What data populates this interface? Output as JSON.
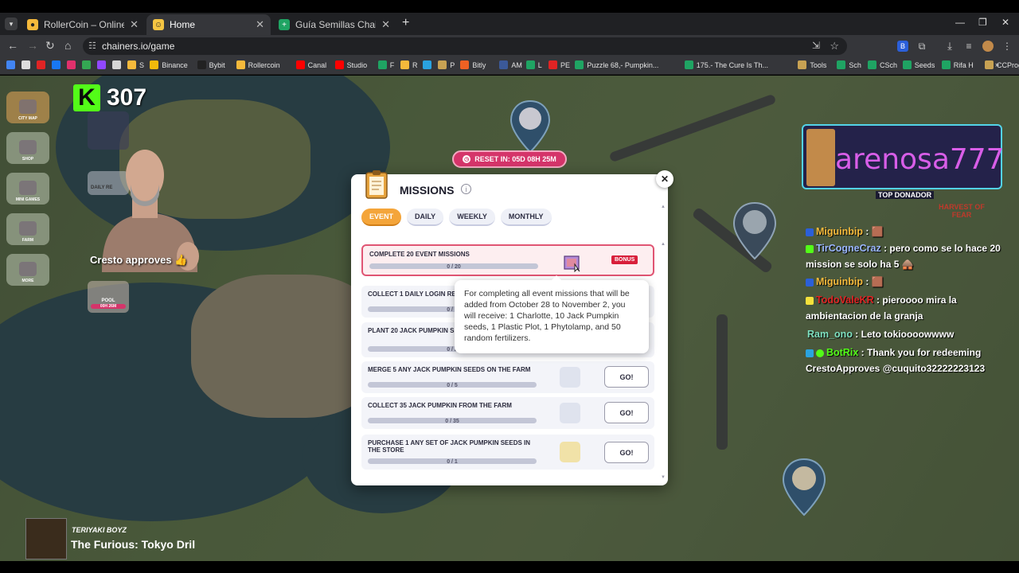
{
  "browser": {
    "tabs": [
      {
        "title": "RollerCoin – Online Bitcoin Mi",
        "fav_color": "#f5b93b",
        "active": false
      },
      {
        "title": "Home",
        "fav_color": "#f5c542",
        "active": true
      },
      {
        "title": "Guía Semillas Chainers by Piero",
        "fav_color": "#1fa463",
        "active": false
      }
    ],
    "url": "chainers.io/game",
    "bookmarks": [
      {
        "label": "",
        "color": "#4285f4"
      },
      {
        "label": "",
        "color": "#ddd"
      },
      {
        "label": "",
        "color": "#e02424"
      },
      {
        "label": "",
        "color": "#1877f2"
      },
      {
        "label": "",
        "color": "#e1306c"
      },
      {
        "label": "",
        "color": "#34a853"
      },
      {
        "label": "",
        "color": "#9147ff"
      },
      {
        "label": "",
        "color": "#d6d6d6"
      },
      {
        "label": "S",
        "color": "#f5b93b"
      },
      {
        "label": "Binance",
        "color": "#f0b90b"
      },
      {
        "label": "Bybit",
        "color": "#222"
      },
      {
        "label": "Rollercoin",
        "color": "#f5b93b"
      },
      {
        "label": "Canal",
        "color": "#ff0000"
      },
      {
        "label": "Studio",
        "color": "#ff0000"
      },
      {
        "label": "F",
        "color": "#1fa463"
      },
      {
        "label": "R",
        "color": "#f5b93b"
      },
      {
        "label": "",
        "color": "#2aa3e0"
      },
      {
        "label": "P",
        "color": "#c8a253"
      },
      {
        "label": "Bitly",
        "color": "#ee6123"
      },
      {
        "label": "AM",
        "color": "#3b5998"
      },
      {
        "label": "L",
        "color": "#1fa463"
      },
      {
        "label": "PE",
        "color": "#e02424"
      },
      {
        "label": "Puzzle 68,- Pumpkin...",
        "color": "#1fa463"
      },
      {
        "label": "175.- The Cure Is Th...",
        "color": "#1fa463"
      },
      {
        "label": "Tools",
        "color": "#c8a253"
      },
      {
        "label": "Sch",
        "color": "#1fa463"
      },
      {
        "label": "CSch",
        "color": "#1fa463"
      },
      {
        "label": "Seeds",
        "color": "#1fa463"
      },
      {
        "label": "Rifa H",
        "color": "#1fa463"
      },
      {
        "label": "CCProgram",
        "color": "#c8a253"
      }
    ]
  },
  "stream": {
    "kick_count": "307",
    "kick_letter": "K",
    "caption": "Cresto approves 👍",
    "donor_name": "arenosa777",
    "donor_label": "TOP DONADOR",
    "song_artist": "TERIYAKI BOYZ",
    "song_track": "The Furious: Tokyo Dril"
  },
  "game": {
    "reset_label": "RESET IN: 05D 08H 25M",
    "nav": [
      {
        "label": "CITY MAP"
      },
      {
        "label": "SHOP"
      },
      {
        "label": "MINI GAMES"
      },
      {
        "label": "FARM"
      },
      {
        "label": "MORE"
      }
    ],
    "map_labels": {
      "daily": "DAILY RE",
      "pool": "POOL",
      "pool_time": "00H 26M",
      "harvest": "HARVEST OF FEAR"
    }
  },
  "missions": {
    "title": "MISSIONS",
    "close": "✕",
    "tabs": [
      "EVENT",
      "DAILY",
      "WEEKLY",
      "MONTHLY"
    ],
    "bonus": {
      "name": "COMPLETE 20 EVENT MISSIONS",
      "progress": "0 / 20",
      "tag": "BONUS"
    },
    "items": [
      {
        "name": "COLLECT 1 DAILY LOGIN RE",
        "progress": "0 / 1",
        "go": ""
      },
      {
        "name": "PLANT 20 JACK PUMPKIN S",
        "progress": "0 / 2",
        "go": ""
      },
      {
        "name": "MERGE 5 ANY JACK PUMPKIN SEEDS ON THE FARM",
        "progress": "0 / 5",
        "go": "GO!"
      },
      {
        "name": "COLLECT 35 JACK PUMPKIN FROM THE FARM",
        "progress": "0 / 35",
        "go": "GO!"
      },
      {
        "name": "PURCHASE 1 ANY SET OF JACK PUMPKIN SEEDS IN THE STORE",
        "progress": "0 / 1",
        "go": "GO!"
      }
    ],
    "tooltip": "For completing all event missions that will be added from October 28 to November 2, you will receive: 1 Charlotte, 10 Jack Pumpkin seeds, 1 Plastic Plot, 1 Phytolamp, and 50 random fertilizers."
  },
  "chat": [
    {
      "user": "Miguinbip",
      "text": " : 🟫",
      "color": "#f5b93b"
    },
    {
      "user": "TirCogneCraz",
      "text": " : pero como se lo hace 20 mission se solo ha 5 🛖",
      "color": "#9bb7ff"
    },
    {
      "user": "Miguinbip",
      "text": " : 🟫",
      "color": "#f5b93b"
    },
    {
      "user": "TodoValeKR",
      "text": " : pieroooo mira la ambientacion de la granja",
      "color": "#e02424"
    },
    {
      "user": "Ram_ono",
      "text": " : Leto tokioooowwww",
      "color": "#7ee0c0"
    },
    {
      "user": "BotRix",
      "text": " : Thank you for redeeming CrestoApproves @cuquito32222223123",
      "color": "#53fc18"
    }
  ]
}
